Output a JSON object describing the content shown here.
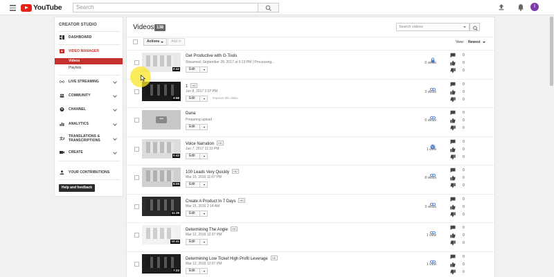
{
  "header": {
    "logo_text": "YouTube",
    "search_placeholder": "Search",
    "avatar_letter": "I"
  },
  "sidebar": {
    "title": "CREATOR STUDIO",
    "items": [
      {
        "label": "DASHBOARD",
        "icon": "dashboard-icon"
      },
      {
        "label": "VIDEO MANAGER",
        "icon": "video-manager-icon"
      },
      {
        "label": "LIVE STREAMING",
        "icon": "live-streaming-icon"
      },
      {
        "label": "COMMUNITY",
        "icon": "community-icon"
      },
      {
        "label": "CHANNEL",
        "icon": "channel-icon"
      },
      {
        "label": "ANALYTICS",
        "icon": "analytics-icon"
      },
      {
        "label": "TRANSLATIONS & TRANSCRIPTIONS",
        "icon": "translations-icon"
      },
      {
        "label": "CREATE",
        "icon": "create-icon"
      },
      {
        "label": "YOUR CONTRIBUTIONS",
        "icon": "contributions-icon"
      }
    ],
    "sub_items": [
      "Videos",
      "Playlists"
    ],
    "help_label": "Help and feedback"
  },
  "main": {
    "title": "Videos",
    "count": "138",
    "search_placeholder": "Search videos",
    "actions_label": "Actions",
    "add_to_label": "Add to",
    "view_label": "View:",
    "view_value": "Newest",
    "edit_label": "Edit",
    "improve_label": "Improve this video"
  },
  "videos": [
    {
      "title": "Get Productive with G-Tools",
      "hd": false,
      "meta": "Streamed: September 28, 2017 at 6:13 PM | Processing...",
      "duration": "0:42",
      "privacy": "private",
      "views": "0 views",
      "comments": "0",
      "likes": "0",
      "dislikes": "0",
      "thumb": "#e9e9e9"
    },
    {
      "title": "1",
      "hd": true,
      "meta": "Jun 8, 2017 2:07 PM",
      "duration": "3:58",
      "privacy": "unlisted",
      "views": "3 views",
      "comments": "0",
      "likes": "0",
      "dislikes": "0",
      "thumb": "#1a1a1a",
      "improve": true
    },
    {
      "title": "Dana",
      "hd": false,
      "meta": "Preparing upload",
      "duration": "",
      "privacy": "unlisted",
      "views": "0 views",
      "comments": "0",
      "likes": "0",
      "dislikes": "0",
      "thumb": "#c8c8c8"
    },
    {
      "title": "Voice Narration",
      "hd": true,
      "meta": "Jun 7, 2017 11:31 PM",
      "duration": "0:42",
      "privacy": "public",
      "views": "1 view",
      "comments": "0",
      "likes": "0",
      "dislikes": "0",
      "thumb": "#dcdcdc"
    },
    {
      "title": "100 Leads Very Quickly",
      "hd": true,
      "meta": "Mar 15, 2016 11:07 PM",
      "duration": "8:05",
      "privacy": "unlisted",
      "views": "8 views",
      "comments": "0",
      "likes": "0",
      "dislikes": "0",
      "thumb": "#d0d0d0"
    },
    {
      "title": "Create A Product In 7 Days",
      "hd": true,
      "meta": "Mar 15, 2016 2:14 AM",
      "duration": "11:39",
      "privacy": "unlisted",
      "views": "3 views",
      "comments": "0",
      "likes": "0",
      "dislikes": "0",
      "thumb": "#2b2b2b"
    },
    {
      "title": "Determining The Angle",
      "hd": true,
      "meta": "Mar 12, 2016 12:07 PM",
      "duration": "10:41",
      "privacy": "unlisted",
      "views": "1 view",
      "comments": "0",
      "likes": "0",
      "dislikes": "0",
      "thumb": "#f2f2f2"
    },
    {
      "title": "Determining Low Ticket High Profit Leverage",
      "hd": true,
      "meta": "Mar 12, 2016 12:07 PM",
      "duration": "7:23",
      "privacy": "unlisted",
      "views": "1 view",
      "comments": "0",
      "likes": "0",
      "dislikes": "0",
      "thumb": "#1e1e1e"
    }
  ],
  "colors": {
    "accent": "#c4302b",
    "link_icon": "#4a7fd1",
    "private_icon": "#4a7fd1"
  }
}
